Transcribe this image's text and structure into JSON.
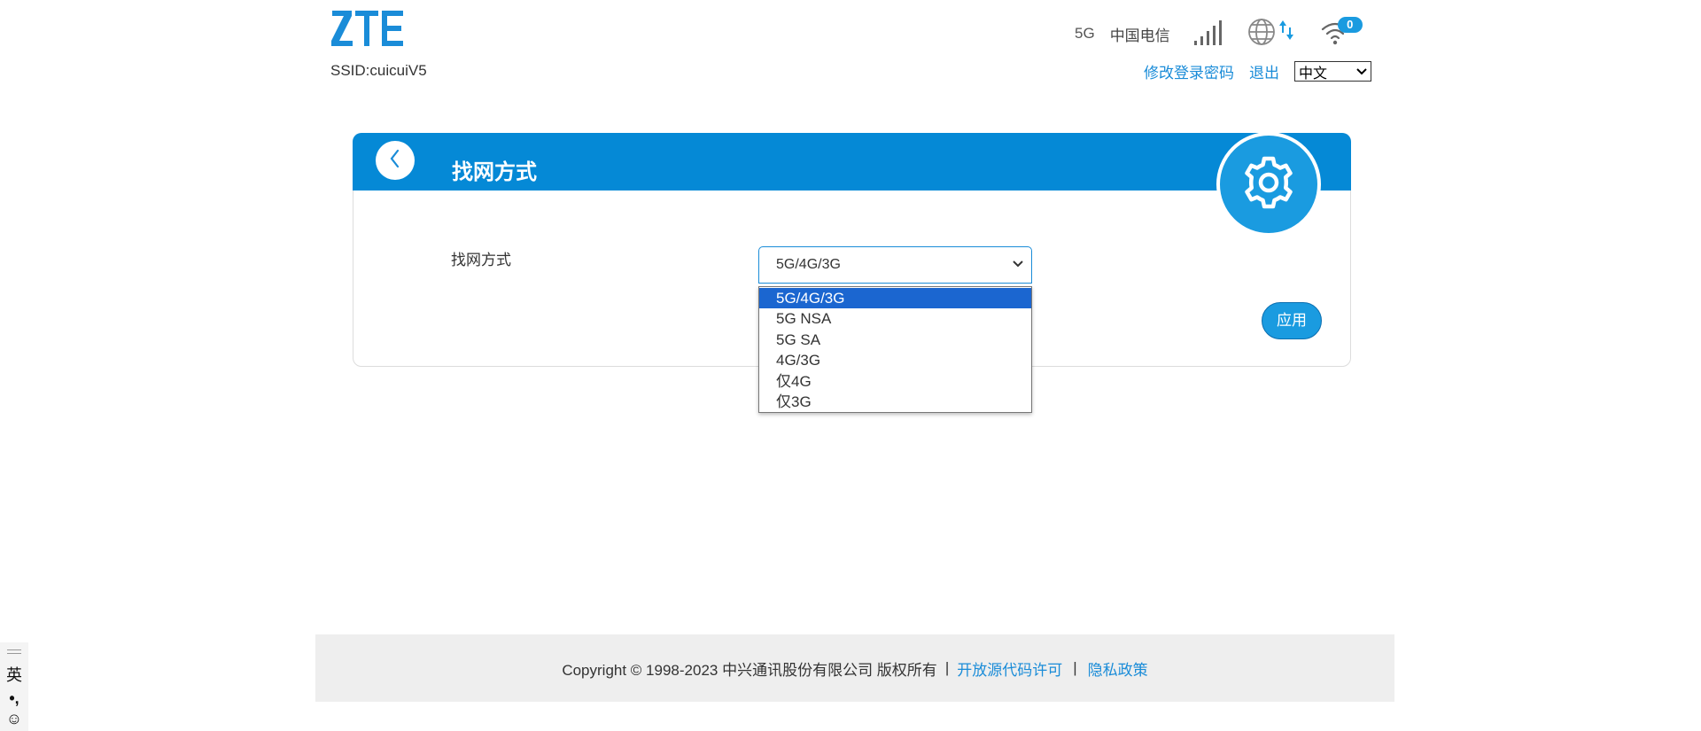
{
  "header": {
    "logo_text": "ZTE",
    "ssid": "SSID:cuicuiV5",
    "network_type": "5G",
    "carrier": "中国电信",
    "connected_devices": "0",
    "change_password_link": "修改登录密码",
    "logout_link": "退出",
    "language_value": "中文"
  },
  "card": {
    "title": "找网方式",
    "field_label": "找网方式",
    "select_value": "5G/4G/3G",
    "options": [
      "5G/4G/3G",
      "5G NSA",
      "5G SA",
      "4G/3G",
      "仅4G",
      "仅3G"
    ],
    "apply_label": "应用"
  },
  "footer": {
    "copyright": "Copyright © 1998-2023 中兴通讯股份有限公司 版权所有",
    "separator": "|",
    "open_source_link": "开放源代码许可",
    "privacy_link": "隐私政策"
  },
  "ime": {
    "mode": "英",
    "punct": "•,",
    "emoji": "☺"
  },
  "colors": {
    "brand_blue": "#0589d6",
    "accent_blue": "#1a9be0",
    "link_blue": "#1a8cd8",
    "selected_option": "#1b66d0"
  }
}
